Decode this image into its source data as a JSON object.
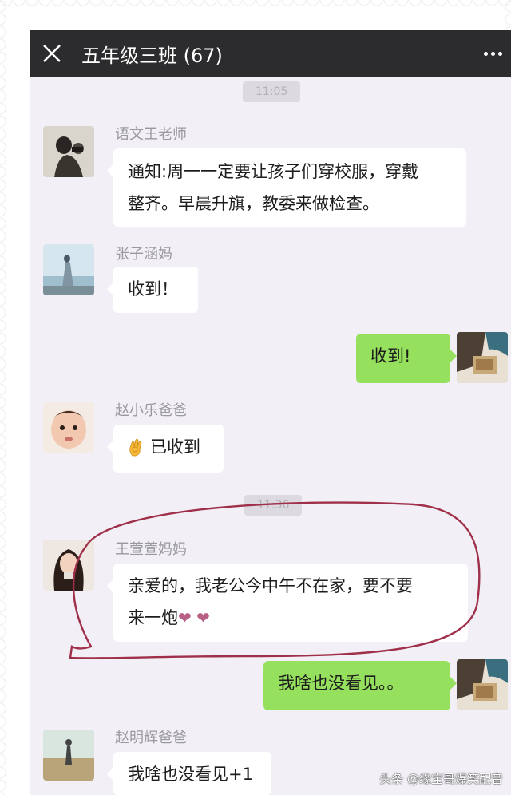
{
  "header": {
    "close_icon": "close-icon",
    "title": "五年级三班 (67)",
    "more_icon": "more-dots-icon"
  },
  "timestamps": [
    "11:05",
    "11:36"
  ],
  "messages": [
    {
      "sender": "语文王老师",
      "text_line1": "通知:周一一定要让孩子们穿校服，穿戴",
      "text_line2": "整齐。早晨升旗，教委来做检查。"
    },
    {
      "sender": "张子涵妈",
      "text": "收到！"
    },
    {
      "sender": "",
      "text": "收到!"
    },
    {
      "sender": "赵小乐爸爸",
      "text": "已收到",
      "icon": "ok-hand-icon"
    },
    {
      "sender": "王萱萱妈妈",
      "text_line1": "亲爱的，我老公今中午不在家，要不要",
      "text_line2": "来一炮",
      "hearts": "❤ ❤"
    },
    {
      "sender": "",
      "text": "我啥也没看见。。"
    },
    {
      "sender": "赵明辉爸爸",
      "text": "我啥也没看见+1"
    }
  ],
  "colors": {
    "title_bar": "#2c2c2e",
    "chat_bg": "#f2eff6",
    "bubble_self": "#95e05d",
    "bubble_other": "#ffffff",
    "annotation": "#a0304a"
  },
  "watermark": "头条 @缘宝哥爆笑配音"
}
